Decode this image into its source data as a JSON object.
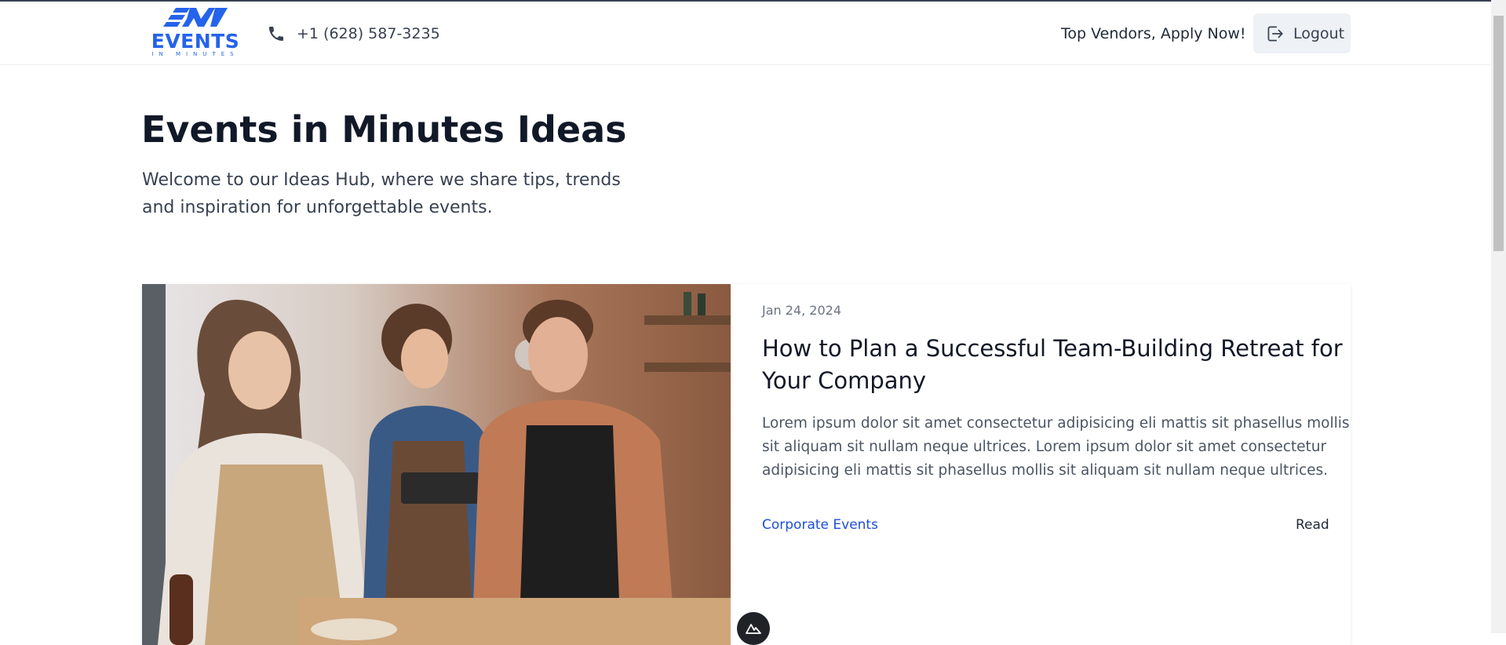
{
  "header": {
    "logo_text": "EVENTS",
    "logo_sub": "IN MINUTES",
    "phone": "+1 (628) 587-3235",
    "vendors_link": "Top Vendors, Apply Now!",
    "logout_label": "Logout"
  },
  "hero": {
    "title": "Events in Minutes Ideas",
    "subtitle": "Welcome to our Ideas Hub, where we share tips, trends and inspiration for unforgettable events."
  },
  "article": {
    "date": "Jan 24, 2024",
    "title": "How to Plan a Successful Team-Building Retreat for Your Company",
    "excerpt": "Lorem ipsum dolor sit amet consectetur adipisicing eli mattis sit phasellus mollis sit aliquam sit nullam neque ultrices. Lorem ipsum dolor sit amet consectetur adipisicing eli mattis sit phasellus mollis sit aliquam sit nullam neque ultrices.",
    "category": "Corporate Events",
    "read_label": "Read"
  },
  "colors": {
    "brand": "#2563eb",
    "link": "#1d4ed8",
    "logout_bg": "#eef1f5"
  },
  "icons": [
    "phone-icon",
    "logout-icon",
    "app-badge-icon"
  ]
}
